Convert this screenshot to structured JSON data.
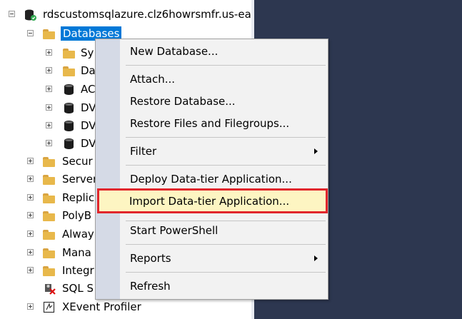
{
  "tree": {
    "server": "rdscustomsqlazure.clz6howrsmfr.us-ea",
    "databases": "Databases",
    "db_children": [
      {
        "label": "Sy",
        "icon": "folder-icon"
      },
      {
        "label": "Da",
        "icon": "folder-icon"
      },
      {
        "label": "AC",
        "icon": "database-icon"
      },
      {
        "label": "DV",
        "icon": "database-icon"
      },
      {
        "label": "DV",
        "icon": "database-icon"
      },
      {
        "label": "DV",
        "icon": "database-icon"
      }
    ],
    "server_children": [
      {
        "label": "Secur"
      },
      {
        "label": "Server"
      },
      {
        "label": "Replic"
      },
      {
        "label": "PolyB"
      },
      {
        "label": "Alway"
      },
      {
        "label": "Mana"
      },
      {
        "label": "Integr"
      }
    ],
    "sql_agent": "SQL S",
    "xevent": "XEvent Profiler"
  },
  "menu": {
    "new_database": "New Database...",
    "attach": "Attach...",
    "restore_database": "Restore Database...",
    "restore_files": "Restore Files and Filegroups...",
    "filter": "Filter",
    "deploy": "Deploy Data-tier Application...",
    "import": "Import Data-tier Application...",
    "powershell": "Start PowerShell",
    "reports": "Reports",
    "refresh": "Refresh"
  },
  "colors": {
    "selection": "#0078d7",
    "highlight_border": "#e1262c",
    "highlight_fill": "#fdf5c2",
    "dark_background": "#2d3750"
  }
}
